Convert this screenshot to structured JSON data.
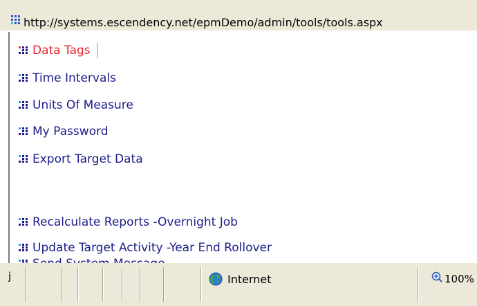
{
  "address_bar": {
    "url": "http://systems.escendency.net/epmDemo/admin/tools/tools.aspx"
  },
  "menu": {
    "items": [
      {
        "label": "Data Tags",
        "active": true
      },
      {
        "label": "Time Intervals",
        "active": false
      },
      {
        "label": "Units Of Measure",
        "active": false
      },
      {
        "label": "My Password",
        "active": false
      },
      {
        "label": "Export Target Data",
        "active": false
      },
      {
        "label": "Recalculate Reports -Overnight Job",
        "active": false
      },
      {
        "label": "Update Target Activity -Year End Rollover",
        "active": false
      },
      {
        "label": "Send System Message",
        "active": false
      }
    ],
    "colors": {
      "link": "#1c1c8c",
      "active": "#e8252d",
      "bullet": "#1c1c8c"
    }
  },
  "status_bar": {
    "left_text": "j",
    "zone": "Internet",
    "zoom": "100%"
  }
}
